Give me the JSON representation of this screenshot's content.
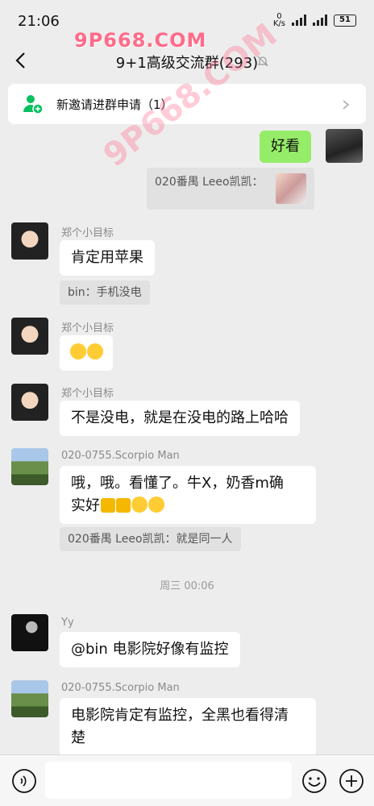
{
  "status": {
    "time": "21:06",
    "net_speed": "0",
    "net_unit": "K/s",
    "battery": "51"
  },
  "watermark": {
    "top": "9P668.COM",
    "diag": "9P668.COM"
  },
  "header": {
    "title": "9+1高级交流群(293)"
  },
  "invite": {
    "label": "新邀请进群申请（1）"
  },
  "messages": {
    "m1": {
      "text": "好看"
    },
    "m1q": {
      "text": "020番禺 Leeo凯凯："
    },
    "m2": {
      "name": "郑个小目标",
      "text": "肯定用苹果",
      "quote": "bin：手机没电"
    },
    "m3": {
      "name": "郑个小目标"
    },
    "m4": {
      "name": "郑个小目标",
      "text": "不是没电，就是在没电的路上哈哈"
    },
    "m5": {
      "name": "020-0755.Scorpio Man",
      "line1": "哦，哦。看懂了。牛X，奶香m确",
      "line2": "实好",
      "quote": "020番禺 Leeo凯凯：就是同一人"
    },
    "divider": "周三 00:06",
    "m6": {
      "name": "Yy",
      "text": "@bin  电影院好像有监控"
    },
    "m7": {
      "name": "020-0755.Scorpio Man",
      "line1": "电影院肯定有监控，全黑也看得清",
      "line2": "楚"
    }
  },
  "icons": {
    "back": "back-arrow-icon",
    "mute": "bell-muted-icon",
    "voice": "voice-icon",
    "emoji": "emoji-icon",
    "plus": "plus-icon"
  }
}
